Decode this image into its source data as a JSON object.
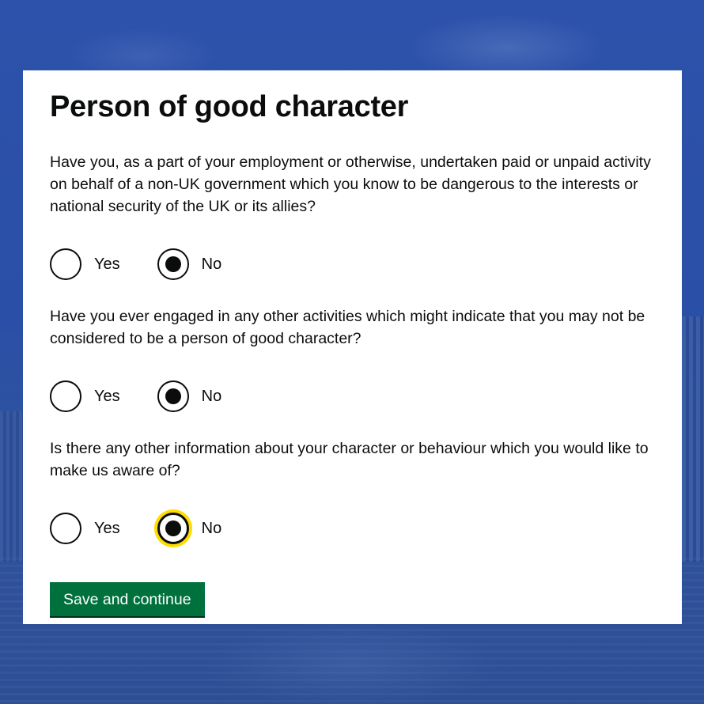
{
  "page": {
    "title": "Person of good character"
  },
  "questions": [
    {
      "text": "Have you, as a part of your employment or otherwise, undertaken paid or unpaid activity on behalf of a non-UK government which you know to be dangerous to the interests or national security of the UK or its allies?",
      "options": [
        "Yes",
        "No"
      ],
      "selected": "No"
    },
    {
      "text": "Have you ever engaged in any other activities which might indicate that you may not be considered to be a person of good character?",
      "options": [
        "Yes",
        "No"
      ],
      "selected": "No"
    },
    {
      "text": "Is there any other information about your character or behaviour which you would like to make us aware of?",
      "options": [
        "Yes",
        "No"
      ],
      "selected": "No",
      "focused": "No"
    }
  ],
  "actions": {
    "submit_label": "Save and continue"
  },
  "colors": {
    "button_green": "#00703c",
    "focus_yellow": "#ffdd00",
    "text": "#0b0c0c",
    "background_blue": "#2d52ab"
  }
}
